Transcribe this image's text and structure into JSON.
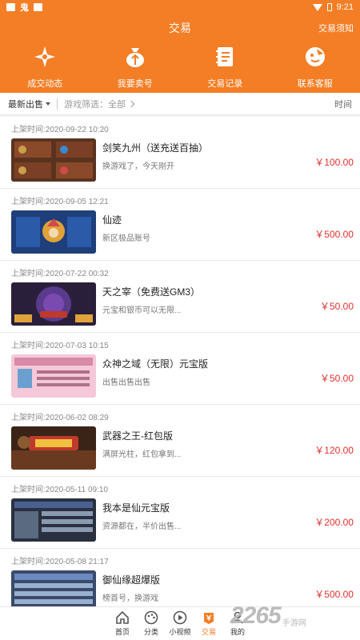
{
  "status": {
    "time": "9:21"
  },
  "header": {
    "title": "交易",
    "notice": "交易须知",
    "actions": [
      {
        "label": "成交动态"
      },
      {
        "label": "我要卖号"
      },
      {
        "label": "交易记录"
      },
      {
        "label": "联系客服"
      }
    ]
  },
  "filter": {
    "sort": "最新出售",
    "game": "游戏筛选：全部",
    "time": "时间"
  },
  "items": [
    {
      "time": "上架时间:2020-09-22 10:20",
      "title": "剑笑九州（送充送百抽）",
      "desc": "换游戏了，今天刚开",
      "price": "￥100.00"
    },
    {
      "time": "上架时间:2020-09-05 12:21",
      "title": "仙迹",
      "desc": "新区极品账号",
      "price": "￥500.00"
    },
    {
      "time": "上架时间:2020-07-22 00:32",
      "title": "天之宰（免费送GM3）",
      "desc": "元宝和银币可以无限...",
      "price": "￥50.00"
    },
    {
      "time": "上架时间:2020-07-03 10:15",
      "title": "众神之域（无限）元宝版",
      "desc": "出售出售出售",
      "price": "￥50.00"
    },
    {
      "time": "上架时间:2020-06-02 08:29",
      "title": "武器之王-红包版",
      "desc": "满屏光柱，红包拿到...",
      "price": "￥120.00"
    },
    {
      "time": "上架时间:2020-05-11 09:10",
      "title": "我本是仙元宝版",
      "desc": "资源都在，半价出售...",
      "price": "￥200.00"
    },
    {
      "time": "上架时间:2020-05-08 21:17",
      "title": "御仙缘超爆版",
      "desc": "榜首号，换游戏",
      "price": "￥500.00"
    }
  ],
  "nav": [
    {
      "label": "首页"
    },
    {
      "label": "分类"
    },
    {
      "label": "小视频"
    },
    {
      "label": "交易"
    },
    {
      "label": "我的"
    }
  ],
  "watermark": {
    "big": "2265",
    "small": "手游网",
    "domain": ".com"
  },
  "colors": {
    "brand": "#f47e25",
    "price": "#e23030"
  }
}
